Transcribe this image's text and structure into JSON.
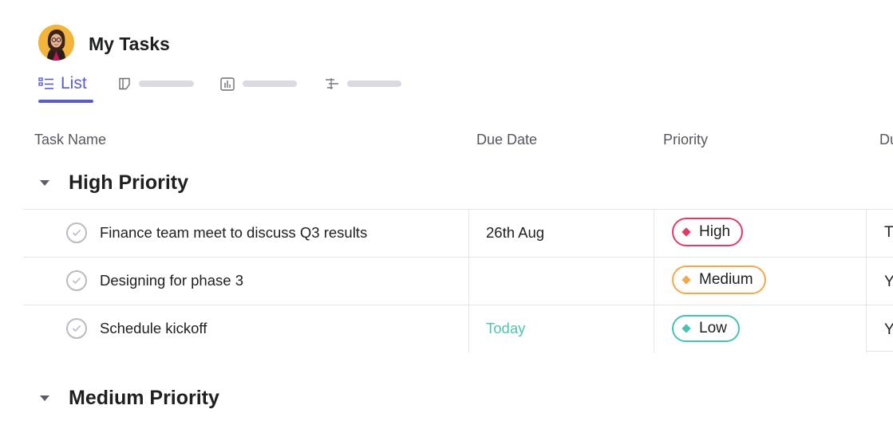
{
  "header": {
    "title": "My Tasks"
  },
  "tabs": {
    "list_label": "List"
  },
  "columns": {
    "task_name": "Task Name",
    "due_date": "Due Date",
    "priority": "Priority",
    "fourth": "Du"
  },
  "sections": [
    {
      "label": "High Priority",
      "rows": [
        {
          "task": "Finance team meet to discuss Q3 results",
          "due": "26th Aug",
          "priority": "High",
          "priority_color": "#e53962",
          "owner": "T"
        },
        {
          "task": "Designing for phase 3",
          "due": "",
          "priority": "Medium",
          "priority_color": "#f5a84b",
          "owner": "Y"
        },
        {
          "task": "Schedule kickoff",
          "due": "Today",
          "due_color": "#4fc4b0",
          "priority": "Low",
          "priority_color": "#45c4b2",
          "owner": "Y"
        }
      ]
    },
    {
      "label": "Medium Priority"
    }
  ]
}
